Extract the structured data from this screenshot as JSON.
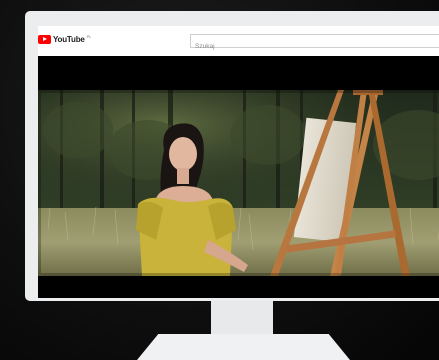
{
  "youtube": {
    "logo_text": "YouTube",
    "region_code": "PL"
  },
  "search": {
    "placeholder": "Szukaj"
  },
  "colors": {
    "brand_red": "#ff0000",
    "monitor_bezel": "#ecedef",
    "background": "#0d0d0d"
  },
  "video": {
    "scene": "woman-by-easel-in-field"
  }
}
